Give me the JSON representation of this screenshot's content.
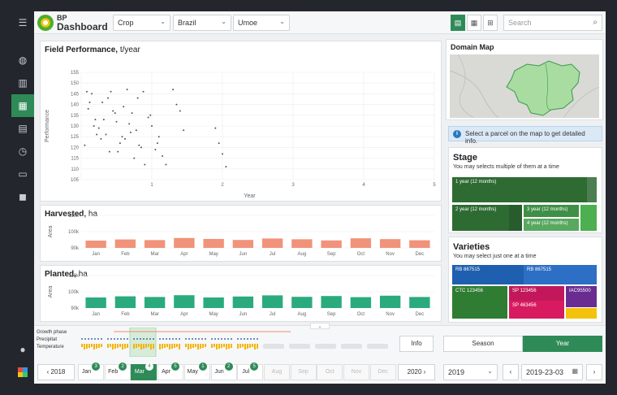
{
  "header": {
    "brand_top": "BP",
    "brand_bottom": "Dashboard",
    "filters": [
      "Crop",
      "Brazil",
      "Umoe"
    ],
    "search_placeholder": "Search"
  },
  "sidebar": {
    "icons": [
      "menu-icon",
      "globe-icon",
      "map-icon",
      "chart-icon",
      "columns-icon",
      "history-icon",
      "clipboard-icon",
      "box-icon",
      "user-icon",
      "layers-icon"
    ]
  },
  "field_performance": {
    "title": "Field Performance,",
    "unit": "t/year"
  },
  "harvested": {
    "title": "Harvested,",
    "unit": "ha"
  },
  "planted": {
    "title": "Planted,",
    "unit": "ha"
  },
  "chart_data": [
    {
      "type": "scatter",
      "title": "Field Performance, t/year",
      "xlabel": "Year",
      "ylabel": "Performance",
      "xlim": [
        0,
        5
      ],
      "ylim": [
        105,
        155
      ],
      "x": [
        0.05,
        0.1,
        0.15,
        0.2,
        0.25,
        0.3,
        0.35,
        0.4,
        0.45,
        0.5,
        0.55,
        0.6,
        0.65,
        0.7,
        0.75,
        0.8,
        0.85,
        0.9,
        0.95,
        1.0,
        1.05,
        1.1,
        1.15,
        1.2,
        1.3,
        1.35,
        1.4,
        1.45,
        1.9,
        1.95,
        2.0,
        2.05,
        0.08,
        0.18,
        0.28,
        0.38,
        0.48,
        0.58,
        0.68,
        0.78,
        0.88,
        0.98,
        1.08,
        0.12,
        0.22,
        0.32,
        0.42,
        0.52,
        0.62,
        0.72,
        0.82
      ],
      "y": [
        121,
        138,
        145,
        133,
        129,
        141,
        126,
        118,
        137,
        132,
        122,
        139,
        147,
        127,
        115,
        143,
        120,
        112,
        134,
        130,
        119,
        125,
        116,
        112,
        147,
        140,
        137,
        128,
        129,
        122,
        117,
        111,
        146,
        130,
        124,
        143,
        136,
        125,
        131,
        128,
        146,
        135,
        122,
        141,
        126,
        133,
        146,
        118,
        124,
        136,
        121
      ]
    },
    {
      "type": "bar",
      "title": "Harvested, ha",
      "ylabel": "Area",
      "categories": [
        "Jan",
        "Feb",
        "Mar",
        "Apr",
        "May",
        "Jun",
        "Jul",
        "Aug",
        "Sep",
        "Oct",
        "Nov",
        "Dec"
      ],
      "ylim": [
        90000,
        110000
      ],
      "series": [
        {
          "values": [
            94500,
            95200,
            94800,
            96100,
            95500,
            94900,
            95800,
            95300,
            94600,
            95900,
            95400,
            94700
          ]
        }
      ]
    },
    {
      "type": "bar",
      "title": "Planted, ha",
      "ylabel": "Area",
      "categories": [
        "Jan",
        "Feb",
        "Mar",
        "Apr",
        "May",
        "Jun",
        "Jul",
        "Aug",
        "Sep",
        "Oct",
        "Nov",
        "Dec"
      ],
      "ylim": [
        90000,
        110000
      ],
      "series": [
        {
          "values": [
            96500,
            97200,
            96800,
            97900,
            96500,
            97100,
            97800,
            96900,
            97400,
            96700,
            97600,
            96800
          ]
        }
      ]
    }
  ],
  "domain_map": {
    "title": "Domain Map"
  },
  "info_text": "Select a parcel on the map to get detailed info.",
  "stage": {
    "title": "Stage",
    "subtitle": "You may selects multiple of them at a time",
    "tiles": [
      "1 year (12 months)",
      "2 year (12 months)",
      "3 year (12 months)",
      "4 year (12 months)"
    ]
  },
  "varieties": {
    "title": "Varieties",
    "subtitle": "You may select just one at a time",
    "tiles": [
      "RB 867515",
      "RB 867515",
      "CTC 123456",
      "SP 123456",
      "SP 463456",
      "IAC95500"
    ]
  },
  "timeline": {
    "labels": [
      "Growth phase",
      "Precipitat",
      "Temperature"
    ],
    "info_label": "Info",
    "season_label": "Season",
    "year_label": "Year"
  },
  "months": {
    "prev_year": "2018",
    "next_year": "2020",
    "items": [
      {
        "m": "Jan",
        "b": "3"
      },
      {
        "m": "Feb",
        "b": "2"
      },
      {
        "m": "Mar",
        "b": "4"
      },
      {
        "m": "Apr",
        "b": "5"
      },
      {
        "m": "May",
        "b": "1"
      },
      {
        "m": "Jun",
        "b": "2"
      },
      {
        "m": "Jul",
        "b": "5"
      },
      {
        "m": "Aug",
        "b": ""
      },
      {
        "m": "Sep",
        "b": ""
      },
      {
        "m": "Oct",
        "b": ""
      },
      {
        "m": "Nov",
        "b": ""
      },
      {
        "m": "Dec",
        "b": ""
      }
    ]
  },
  "year_select": "2019",
  "date_value": "2019-23-03"
}
